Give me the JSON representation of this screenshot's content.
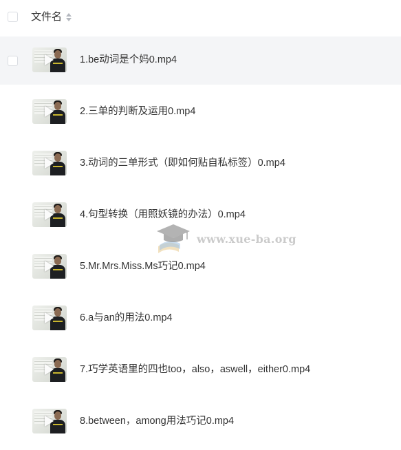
{
  "header": {
    "title": "文件名",
    "sort_icon": "sort-icon"
  },
  "files": [
    {
      "name": "1.be动词是个妈0.mp4",
      "icon": "video-thumbnail"
    },
    {
      "name": "2.三单的判断及运用0.mp4",
      "icon": "video-thumbnail"
    },
    {
      "name": "3.动词的三单形式（即如何贴自私标签）0.mp4",
      "icon": "video-thumbnail"
    },
    {
      "name": "4.句型转换（用照妖镜的办法）0.mp4",
      "icon": "video-thumbnail"
    },
    {
      "name": "5.Mr.Mrs.Miss.Ms巧记0.mp4",
      "icon": "video-thumbnail"
    },
    {
      "name": "6.a与an的用法0.mp4",
      "icon": "video-thumbnail"
    },
    {
      "name": "7.巧学英语里的四也too，also，aswell，either0.mp4",
      "icon": "video-thumbnail"
    },
    {
      "name": "8.between，among用法巧记0.mp4",
      "icon": "video-thumbnail"
    }
  ],
  "hovered_row": 1,
  "watermark": {
    "text": "www.xue-ba.org",
    "icon": "graduation-cap-icon"
  },
  "colors": {
    "hover_bg": "#f4f5f7",
    "text": "#333333",
    "checkbox_border": "#d9dce1"
  }
}
